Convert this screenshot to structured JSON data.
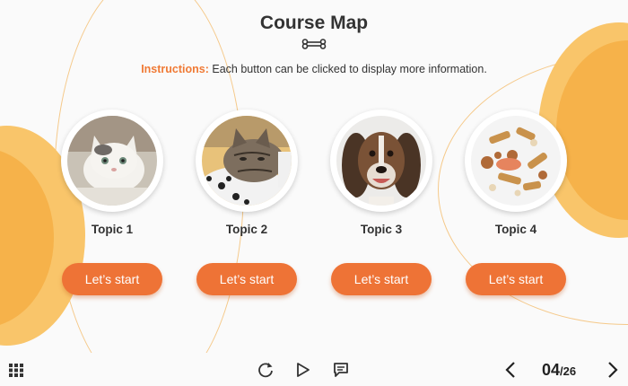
{
  "page": {
    "title": "Course Map",
    "instructions_label": "Instructions:",
    "instructions_text": " Each button can be clicked to display more information."
  },
  "topics": [
    {
      "label": "Topic 1",
      "button": "Let’s start",
      "image": "white-kitten-photo"
    },
    {
      "label": "Topic 2",
      "button": "Let’s start",
      "image": "tabby-cat-photo"
    },
    {
      "label": "Topic 3",
      "button": "Let’s start",
      "image": "dog-photo"
    },
    {
      "label": "Topic 4",
      "button": "Let’s start",
      "image": "dog-treats-photo"
    }
  ],
  "player": {
    "current_page": "04",
    "total_pages": "/26",
    "icons": [
      "grid-menu-icon",
      "replay-icon",
      "play-icon",
      "comment-icon",
      "prev-arrow-icon",
      "next-arrow-icon"
    ]
  },
  "colors": {
    "accent": "#ee7336",
    "deco_light": "#f9c56a",
    "deco_mid": "#f6b24a"
  }
}
